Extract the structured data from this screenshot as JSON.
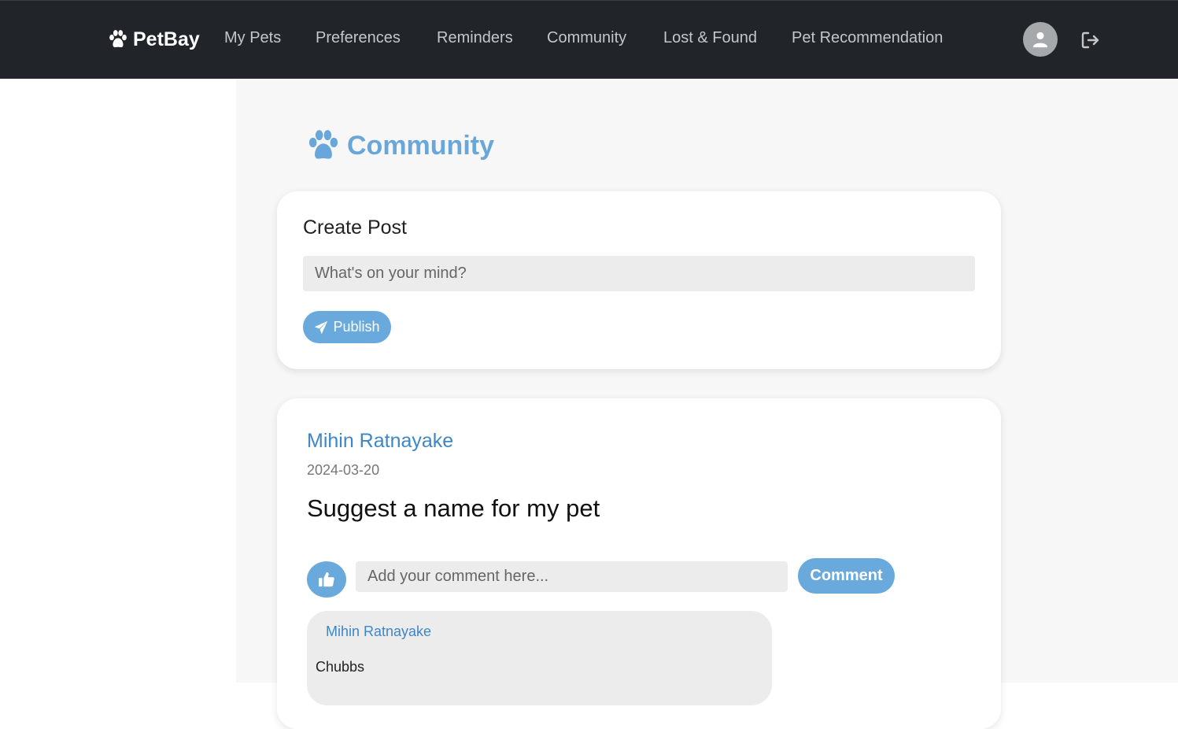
{
  "navbar": {
    "brand": "PetBay",
    "links": [
      "My Pets",
      "Preferences",
      "Reminders",
      "Community",
      "Lost & Found",
      "Pet Recommendation"
    ],
    "profile_icon": "user-circle-icon",
    "logout_icon": "sign-out-icon"
  },
  "page": {
    "title": "Community",
    "title_icon": "paw-icon",
    "accent_color": "#69a6da"
  },
  "create_post": {
    "title": "Create Post",
    "placeholder": "What's on your mind?",
    "value": "",
    "publish_label": "Publish",
    "publish_icon": "paper-plane-icon"
  },
  "posts": [
    {
      "author": "Mihin Ratnayake",
      "date": "2024-03-20",
      "text": "Suggest a name for my pet",
      "like_icon": "thumbs-up-icon",
      "comment_placeholder": "Add your comment here...",
      "comment_label": "Comment",
      "comments": [
        {
          "author": "Mihin Ratnayake",
          "text": "Chubbs"
        }
      ]
    }
  ]
}
